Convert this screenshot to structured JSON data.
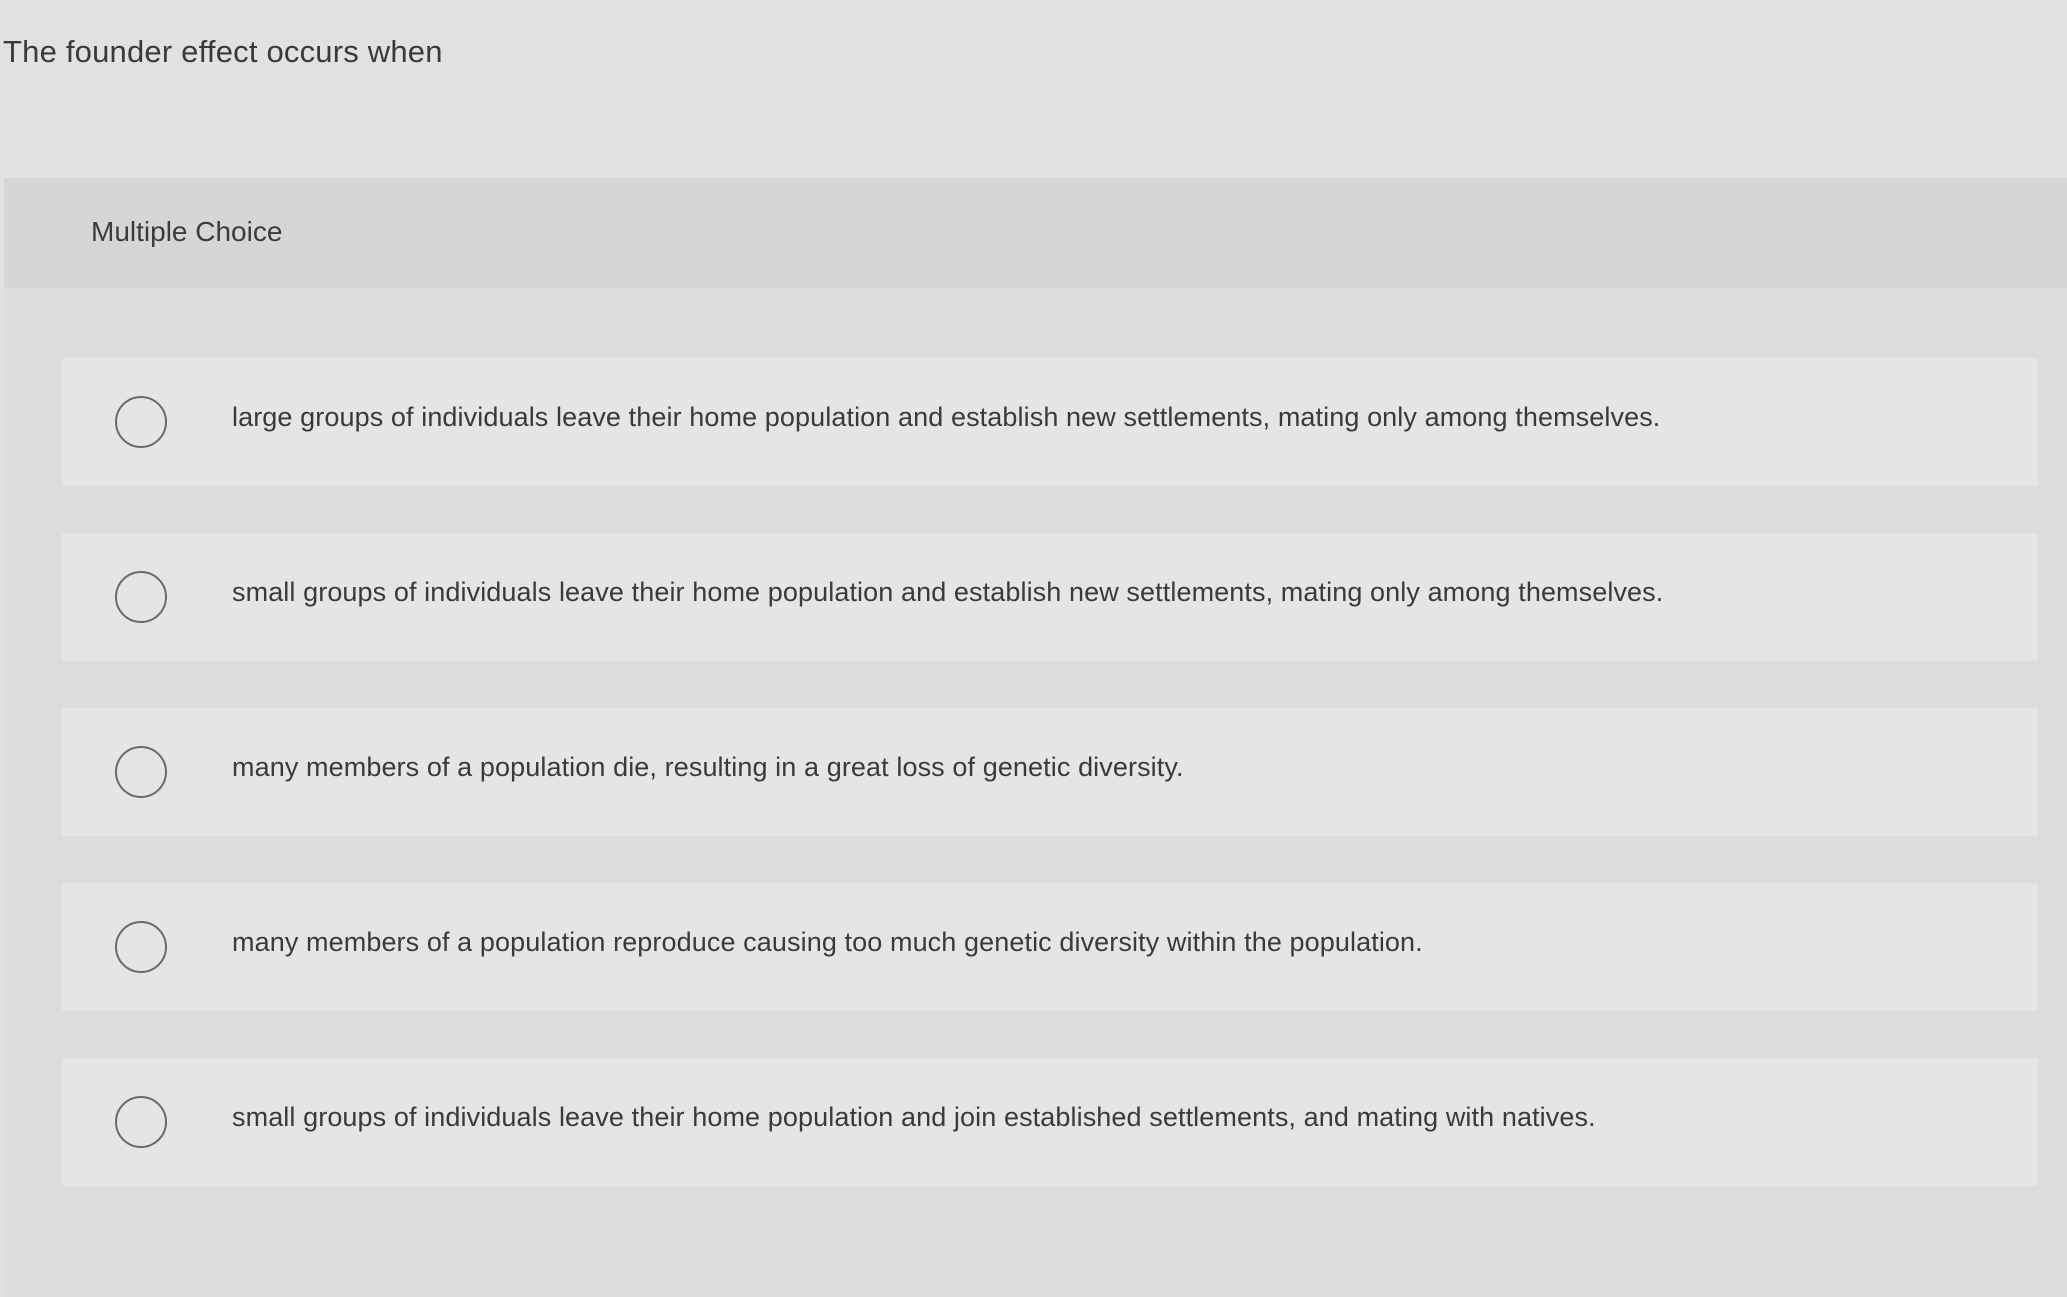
{
  "question": {
    "text": "The founder effect occurs when"
  },
  "multiple_choice": {
    "label": "Multiple Choice",
    "options": [
      {
        "text": "large groups of individuals leave their home population and establish new settlements, mating only among themselves.",
        "selected": false
      },
      {
        "text": "small groups of individuals leave their home population and establish new settlements, mating only among themselves.",
        "selected": false
      },
      {
        "text": "many members of a population die, resulting in a great loss of genetic diversity.",
        "selected": false
      },
      {
        "text": "many members of a population reproduce causing too much genetic diversity within the population.",
        "selected": false
      },
      {
        "text": "small groups of individuals leave their home population and join established settlements, and mating with natives.",
        "selected": false
      }
    ]
  },
  "colors": {
    "background": "#e2e1df",
    "panel": "#dddcda",
    "option_row": "#e6e5e3",
    "text": "#3a3a3a",
    "radio_border": "#6a6a6a"
  }
}
